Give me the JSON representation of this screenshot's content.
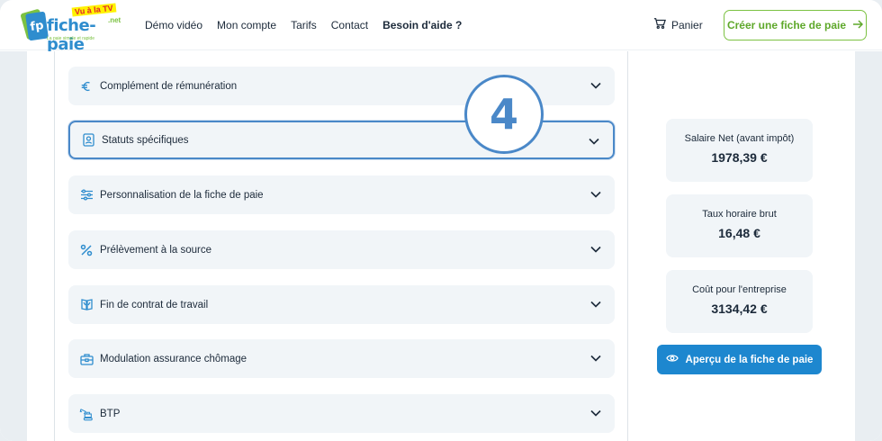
{
  "header": {
    "logo": {
      "name": "fiche-paie",
      "tv": "Vu à la TV",
      "net": ".net",
      "tagline": "La paie simple et rapide"
    },
    "nav": [
      {
        "label": "Démo vidéo",
        "bold": false
      },
      {
        "label": "Mon compte",
        "bold": false
      },
      {
        "label": "Tarifs",
        "bold": false
      },
      {
        "label": "Contact",
        "bold": false
      },
      {
        "label": "Besoin d'aide ?",
        "bold": true
      }
    ],
    "cart_label": "Panier",
    "cta_label": "Créer une fiche de paie"
  },
  "accordion": [
    {
      "label": "Complément de rémunération",
      "icon": "euro-icon",
      "active": false
    },
    {
      "label": "Statuts spécifiques",
      "icon": "badge-icon",
      "active": true
    },
    {
      "label": "Personnalisation de la fiche de paie",
      "icon": "sliders-icon",
      "active": false
    },
    {
      "label": "Prélèvement à la source",
      "icon": "percent-icon",
      "active": false
    },
    {
      "label": "Fin de contrat de travail",
      "icon": "documents-icon",
      "active": false
    },
    {
      "label": "Modulation assurance chômage",
      "icon": "briefcase-icon",
      "active": false
    },
    {
      "label": "BTP",
      "icon": "excavator-icon",
      "active": false
    }
  ],
  "step_marker": "4",
  "summary": [
    {
      "label": "Salaire Net (avant impôt)",
      "value": "1978,39 €"
    },
    {
      "label": "Taux horaire brut",
      "value": "16,48 €"
    },
    {
      "label": "Coût pour l'entreprise",
      "value": "3134,42 €"
    }
  ],
  "preview_button": "Aperçu de la fiche de paie",
  "colors": {
    "brand_blue": "#1d87cf",
    "brand_green": "#7cc242",
    "highlight": "#4a88c8"
  }
}
